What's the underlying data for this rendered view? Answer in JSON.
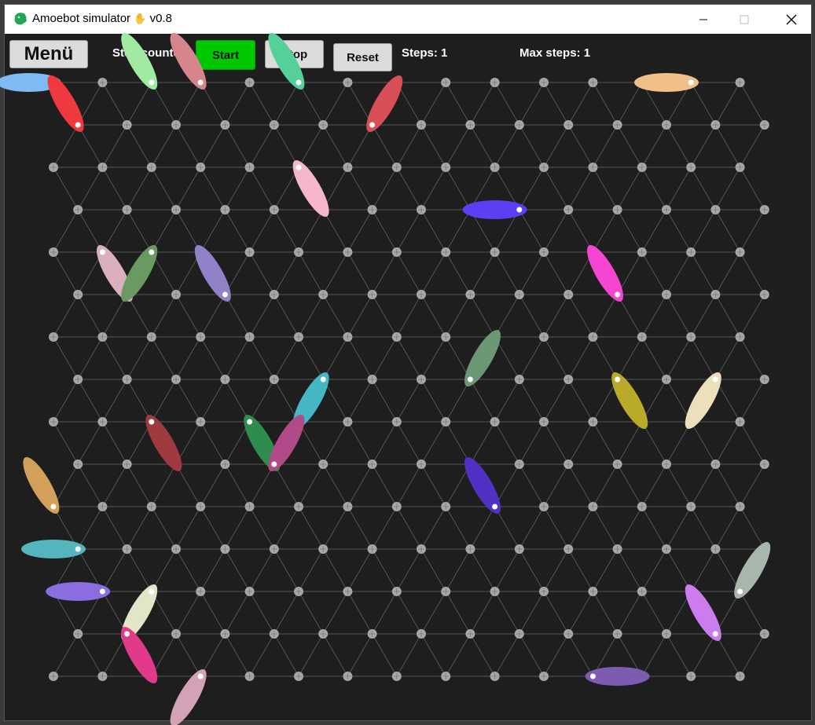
{
  "window": {
    "title": "Amoebot simulator",
    "version": "v0.8",
    "app_icon": "amoeba-icon",
    "title_icon": "hand-icon"
  },
  "controls": {
    "minimize": "minimize-icon",
    "maximize": "maximize-icon",
    "close": "close-icon"
  },
  "toolbar": {
    "menu_label": "Menü",
    "step_counter_label": "Step counter",
    "start_label": "Start",
    "stop_label": "Stop",
    "reset_label": "Reset",
    "steps_text": "Steps: 1",
    "max_steps_text": "Max steps: 1"
  },
  "colors": {
    "background": "#1e1e1e",
    "grid_node": "#a8a8a8",
    "grid_line": "#555555",
    "start_button": "#00c800",
    "button": "#dcdcdc",
    "head_dot": "#ffffff"
  },
  "grid": {
    "description_rows": 15,
    "even_row_columns": 15,
    "odd_row_columns": 15
  },
  "amoebots": [
    {
      "row": 0,
      "col": 0,
      "dir": 0,
      "color": "#7fbbf2"
    },
    {
      "row": 0,
      "col": 2,
      "dir": 5,
      "color": "#a1eaa1"
    },
    {
      "row": 0,
      "col": 3,
      "dir": 5,
      "color": "#d6858c"
    },
    {
      "row": 0,
      "col": 5,
      "dir": 5,
      "color": "#55d09b"
    },
    {
      "row": 0,
      "col": 13,
      "dir": 0,
      "color": "#f0c088"
    },
    {
      "row": 1,
      "col": 0,
      "dir": 5,
      "color": "#ee3a3e"
    },
    {
      "row": 1,
      "col": 6,
      "dir": 4,
      "color": "#d84f58"
    },
    {
      "row": 2,
      "col": 5,
      "dir": 2,
      "color": "#f6b6cc"
    },
    {
      "row": 3,
      "col": 9,
      "dir": 0,
      "color": "#5c3ff2"
    },
    {
      "row": 4,
      "col": 1,
      "dir": 2,
      "color": "#dab0c0"
    },
    {
      "row": 4,
      "col": 2,
      "dir": 1,
      "color": "#6a9a62"
    },
    {
      "row": 5,
      "col": 3,
      "dir": 5,
      "color": "#9081c8"
    },
    {
      "row": 5,
      "col": 11,
      "dir": 5,
      "color": "#f545d3"
    },
    {
      "row": 7,
      "col": 5,
      "dir": 1,
      "color": "#45b6c4"
    },
    {
      "row": 7,
      "col": 8,
      "dir": 4,
      "color": "#6b9874"
    },
    {
      "row": 7,
      "col": 11,
      "dir": 2,
      "color": "#b9aa2a"
    },
    {
      "row": 7,
      "col": 13,
      "dir": 1,
      "color": "#ebdfbc"
    },
    {
      "row": 8,
      "col": 2,
      "dir": 2,
      "color": "#9e3a40"
    },
    {
      "row": 8,
      "col": 4,
      "dir": 2,
      "color": "#2d8c4e"
    },
    {
      "row": 9,
      "col": 4,
      "dir": 4,
      "color": "#b04a88"
    },
    {
      "row": 10,
      "col": 0,
      "dir": 5,
      "color": "#d2a058"
    },
    {
      "row": 10,
      "col": 9,
      "dir": 5,
      "color": "#5031c4"
    },
    {
      "row": 11,
      "col": 0,
      "dir": 0,
      "color": "#55b5bf"
    },
    {
      "row": 12,
      "col": 2,
      "dir": 1,
      "color": "#e2e6c6"
    },
    {
      "row": 12,
      "col": 1,
      "dir": 0,
      "color": "#8a6ee0"
    },
    {
      "row": 12,
      "col": 14,
      "dir": 4,
      "color": "#a8b6ac"
    },
    {
      "row": 13,
      "col": 1,
      "dir": 2,
      "color": "#e23a8a"
    },
    {
      "row": 13,
      "col": 13,
      "dir": 5,
      "color": "#cd7cf0"
    },
    {
      "row": 14,
      "col": 3,
      "dir": 1,
      "color": "#d4a2b6"
    },
    {
      "row": 14,
      "col": 11,
      "dir": 3,
      "color": "#7b5cb0"
    }
  ]
}
